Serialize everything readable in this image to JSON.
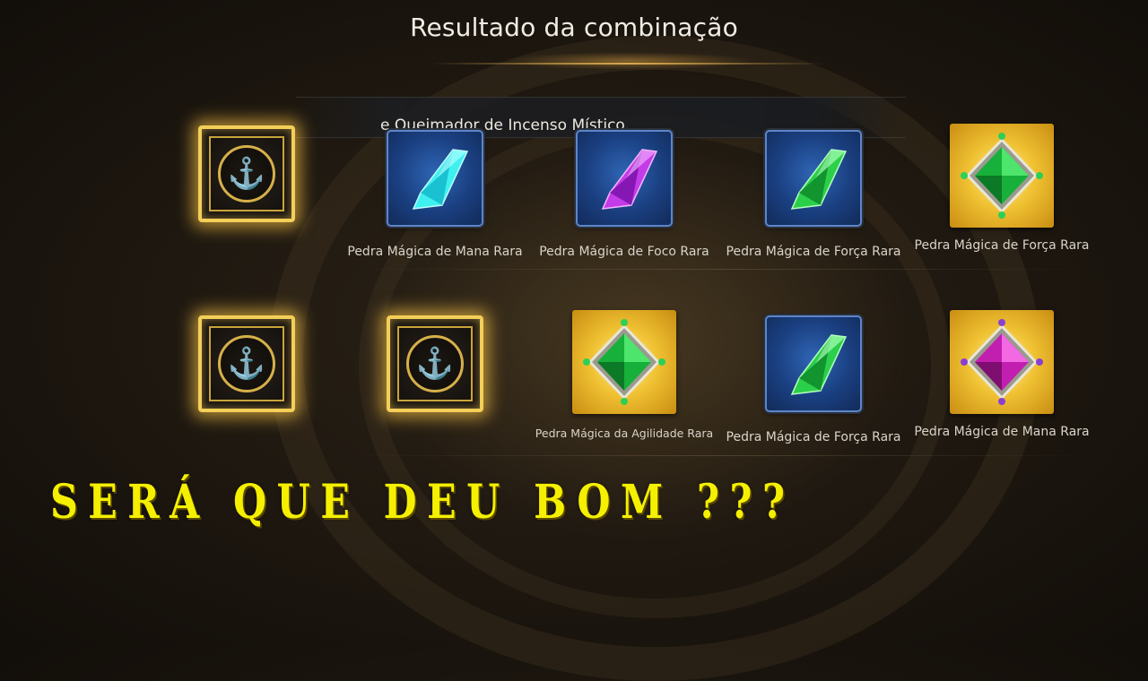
{
  "title": "Resultado da combinação",
  "notice": "e Queimador de Incenso Místico.",
  "overlay_caption": "SERÁ QUE DEU BOM ???",
  "colors": {
    "gold": "#f3cf58",
    "caption": "#f5f000",
    "rare_blue": "#1a3f80"
  },
  "rows": [
    {
      "items": [
        {
          "kind": "dragon-box",
          "icon": "dragon-icon",
          "label": ""
        },
        {
          "kind": "rare",
          "gem_color": "cyan",
          "label": "Pedra Mágica de Mana Rara"
        },
        {
          "kind": "rare",
          "gem_color": "purple",
          "label": "Pedra Mágica de Foco Rara"
        },
        {
          "kind": "rare",
          "gem_color": "green",
          "label": "Pedra Mágica de Força Rara"
        },
        {
          "kind": "legendary",
          "gem_color": "green",
          "label": "Pedra Mágica de Força Rara"
        }
      ]
    },
    {
      "items": [
        {
          "kind": "dragon-box",
          "icon": "dragon-icon",
          "label": ""
        },
        {
          "kind": "dragon-box",
          "icon": "dragon-icon",
          "label": ""
        },
        {
          "kind": "legendary",
          "gem_color": "green",
          "label": "Pedra Mágica da Agilidade Rara"
        },
        {
          "kind": "rare",
          "gem_color": "green",
          "label": "Pedra Mágica de Força Rara"
        },
        {
          "kind": "legendary",
          "gem_color": "magenta",
          "label": "Pedra Mágica de Mana Rara"
        }
      ]
    }
  ]
}
